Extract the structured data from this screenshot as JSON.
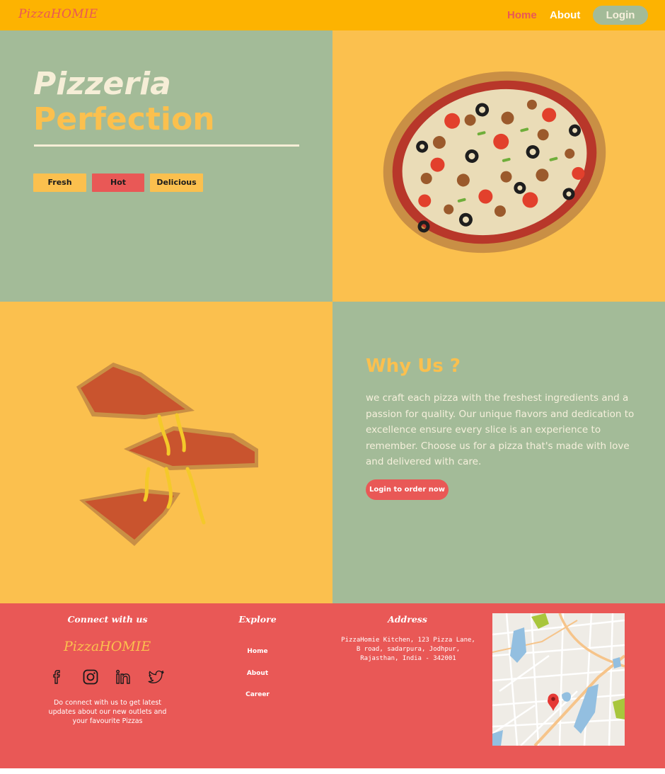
{
  "nav": {
    "brand": "PizzaHOMIE",
    "links": [
      "Home",
      "About"
    ],
    "login": "Login"
  },
  "hero": {
    "title_line1": "Pizzeria",
    "title_line2": "Perfection",
    "tags": [
      "Fresh",
      "Hot",
      "Delicious"
    ]
  },
  "why": {
    "title": "Why Us ?",
    "text": "we craft each pizza with the freshest ingredients and a passion for quality. Our unique flavors and dedication to excellence ensure every slice is an experience to remember. Choose us for a pizza that's made with love and delivered with care.",
    "button": "Login to order now"
  },
  "footer": {
    "connect": {
      "heading": "Connect with us",
      "brand": "PizzaHOMIE",
      "blurb": "Do connect with us to get latest updates about our new outlets and your favourite Pizzas",
      "icons": [
        "facebook-icon",
        "instagram-icon",
        "linkedin-icon",
        "twitter-icon"
      ]
    },
    "explore": {
      "heading": "Explore",
      "links": [
        "Home",
        "About",
        "Career"
      ]
    },
    "address": {
      "heading": "Address",
      "text": "PizzaHomie Kitchen, 123 Pizza Lane, B road, sadarpura, Jodhpur, Rajasthan, India - 342001"
    }
  },
  "colors": {
    "nav": "#fdb301",
    "sage": "#a3bb98",
    "mustard": "#fbc04e",
    "coral": "#e95856",
    "cream": "#f6eed7"
  }
}
